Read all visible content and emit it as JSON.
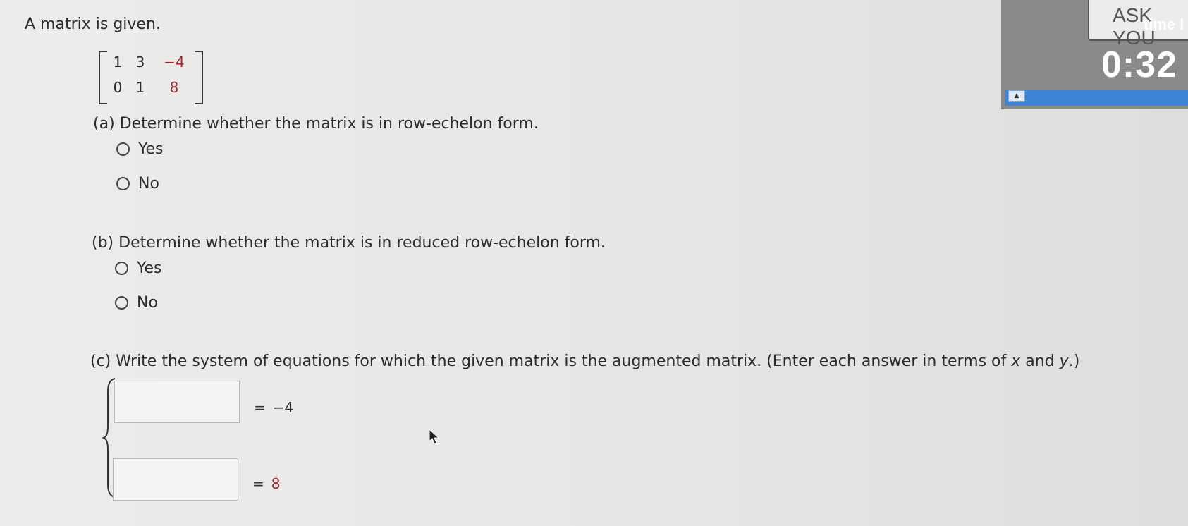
{
  "intro_text": "A matrix is given.",
  "matrix": {
    "row1": [
      "1",
      "3",
      "−4"
    ],
    "row2": [
      "0",
      "1",
      "8"
    ]
  },
  "part_a": {
    "question": "(a) Determine whether the matrix is in row-echelon form.",
    "options": [
      "Yes",
      "No"
    ]
  },
  "part_b": {
    "question": "(b) Determine whether the matrix is in reduced row-echelon form.",
    "options": [
      "Yes",
      "No"
    ]
  },
  "part_c": {
    "question": "(c) Write the system of equations for which the given matrix is the augmented matrix. (Enter each answer in terms of ",
    "var_x": "x",
    "and_text": " and ",
    "var_y": "y",
    "end_text": ".)",
    "equations": [
      {
        "equals": "=",
        "rhs": "−4",
        "value": ""
      },
      {
        "equals": "=",
        "rhs": "8",
        "value": ""
      }
    ]
  },
  "timer": {
    "ask_label": "ASK YOU",
    "time_label": "time l",
    "clock": "0:32"
  },
  "colors": {
    "accent_red": "#a0242b",
    "timer_bar": "#3c85d6"
  }
}
